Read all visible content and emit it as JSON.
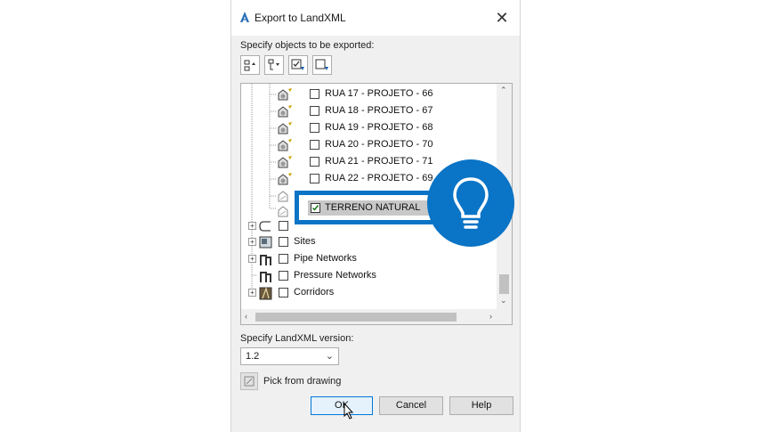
{
  "dialog": {
    "title": "Export to LandXML",
    "close_glyph": "✕",
    "objects_label": "Specify objects to be exported:",
    "version_label": "Specify LandXML version:",
    "version_value": "1.2",
    "version_caret": "⌄",
    "pick_label": "Pick from drawing",
    "ok_label": "OK",
    "cancel_label": "Cancel",
    "help_label": "Help"
  },
  "toolbar": {
    "icons": [
      "expand-all-icon",
      "collapse-all-icon",
      "check-all-icon",
      "uncheck-all-icon"
    ]
  },
  "tree": {
    "surface_items": [
      {
        "label": "RUA 17 - PROJETO - 66",
        "checked": false
      },
      {
        "label": "RUA 18 - PROJETO - 67",
        "checked": false
      },
      {
        "label": "RUA 19 - PROJETO - 68",
        "checked": false
      },
      {
        "label": "RUA 20 - PROJETO - 70",
        "checked": false
      },
      {
        "label": "RUA 21 - PROJETO - 71",
        "checked": false
      },
      {
        "label": "RUA 22 - PROJETO - 69",
        "checked": false
      }
    ],
    "highlighted_item": {
      "label": "TERRENO NATURAL",
      "checked": true
    },
    "groups": [
      {
        "label": "Sites"
      },
      {
        "label": "Pipe Networks"
      },
      {
        "label": "Pressure Networks"
      },
      {
        "label": "Corridors"
      }
    ]
  },
  "overlay": {
    "accent_color": "#0a74c6",
    "icon": "lightbulb-icon"
  }
}
